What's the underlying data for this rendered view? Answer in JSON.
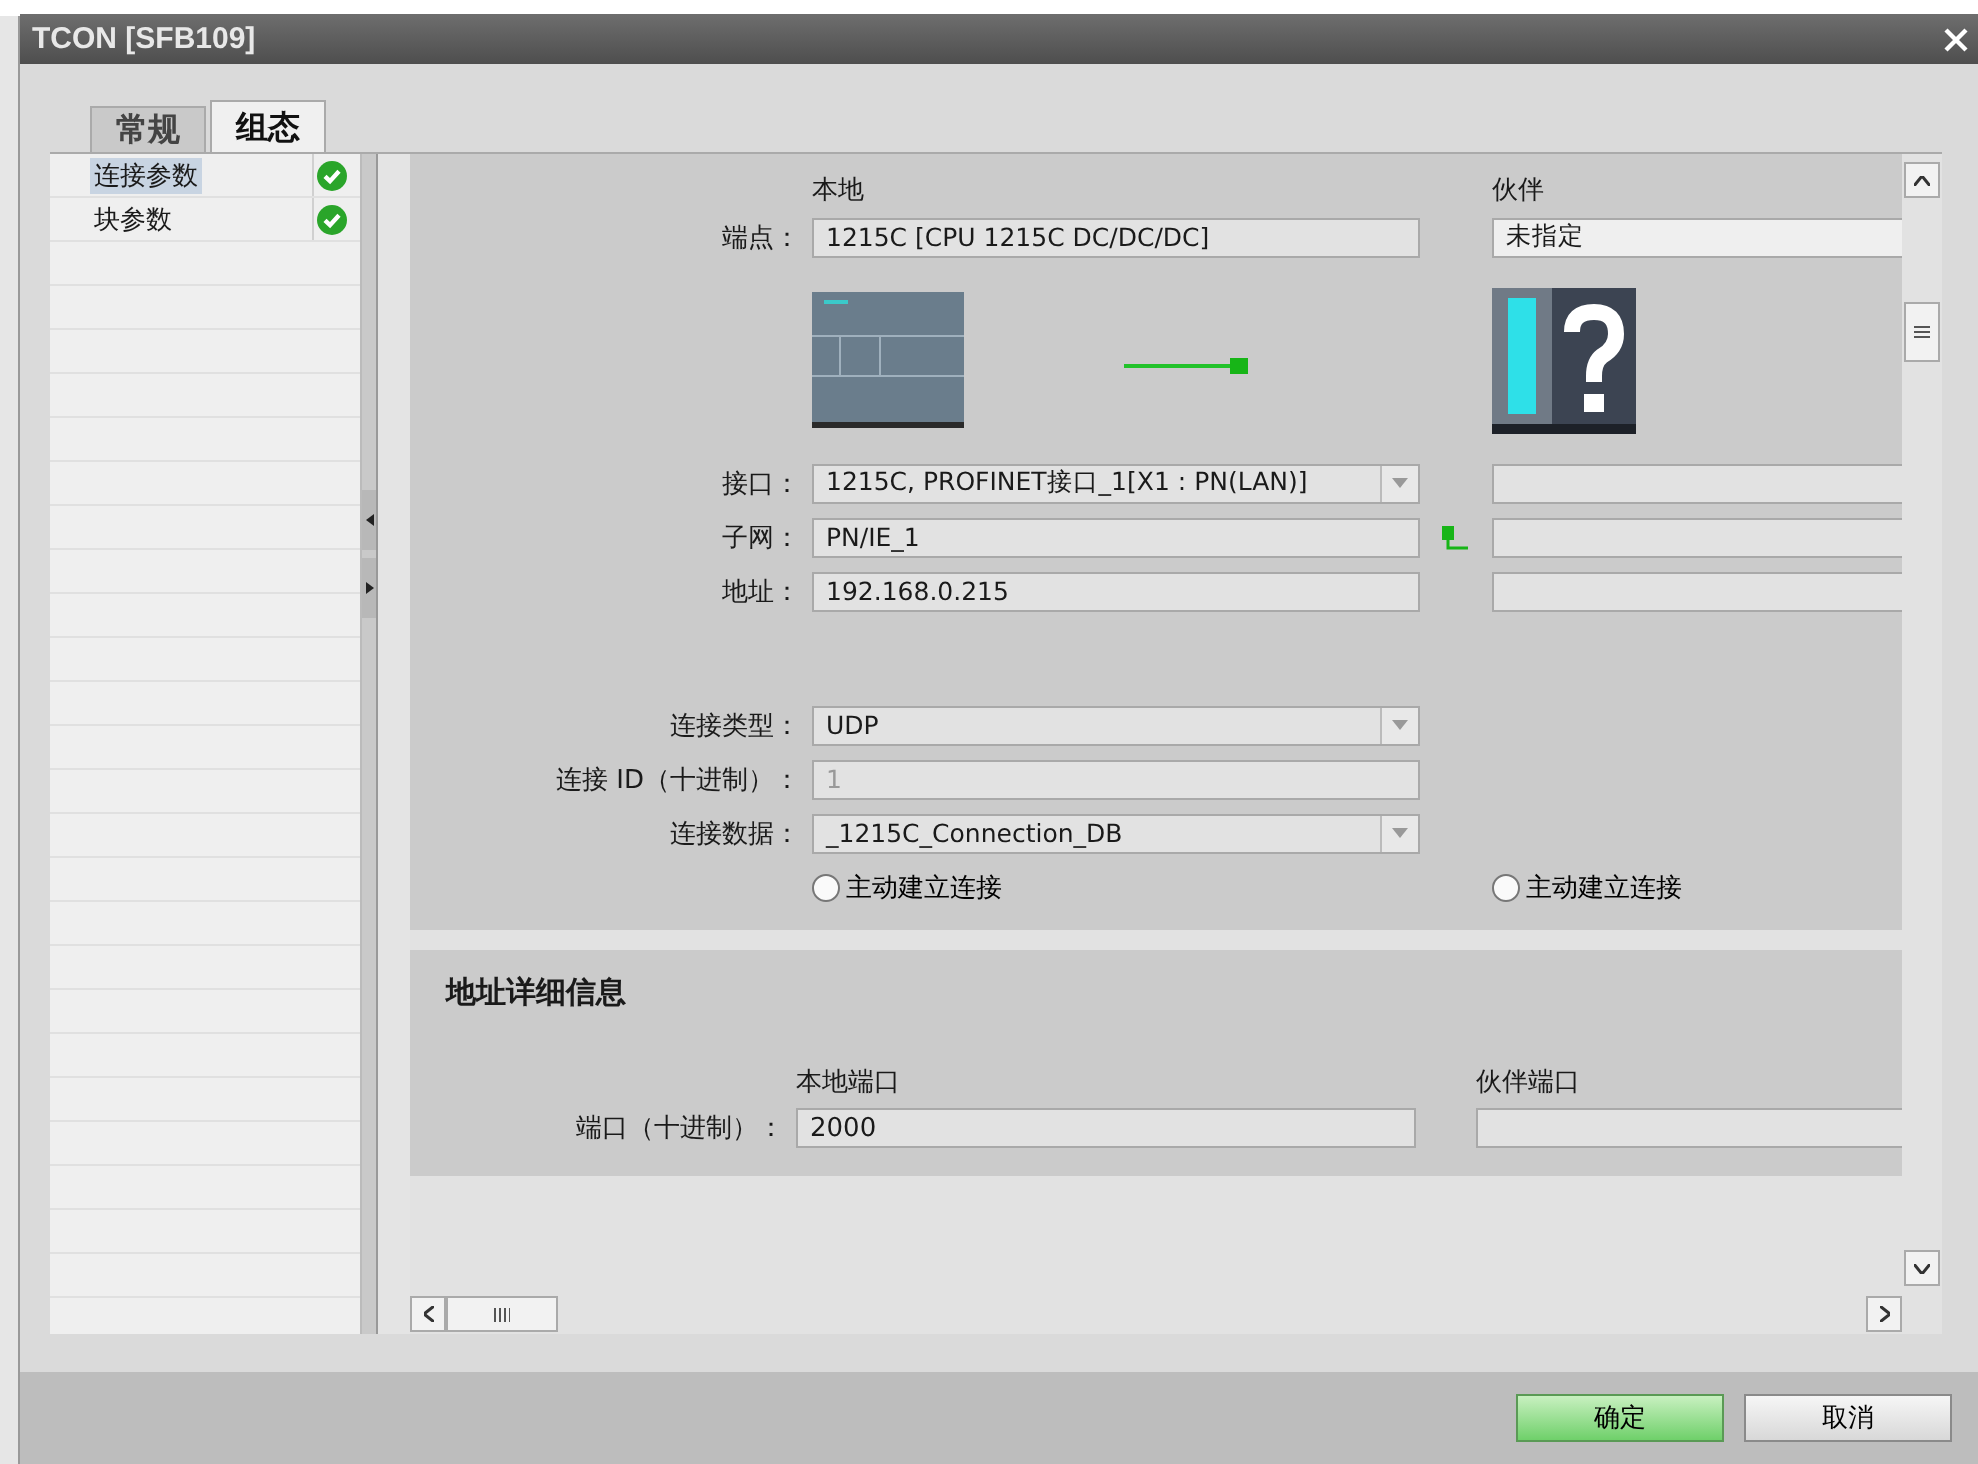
{
  "window": {
    "title": "TCON [SFB109]"
  },
  "tabs": [
    {
      "label": "常规",
      "selected": false
    },
    {
      "label": "组态",
      "selected": true
    }
  ],
  "nav": {
    "items": [
      {
        "label": "连接参数",
        "selected": true,
        "valid": true
      },
      {
        "label": "块参数",
        "selected": false,
        "valid": true
      }
    ]
  },
  "connection": {
    "local_header": "本地",
    "partner_header": "伙伴",
    "endpoint": {
      "label": "端点：",
      "local": "1215C [CPU 1215C DC/DC/DC]",
      "partner": "未指定"
    },
    "fields": [
      {
        "label": "接口：",
        "kind": "dropdown",
        "value": "1215C, PROFINET接口_1[X1 : PN(LAN)]",
        "partner": true,
        "linked": false
      },
      {
        "label": "子网：",
        "kind": "text",
        "value": "PN/IE_1",
        "partner": true,
        "linked": true
      },
      {
        "label": "地址：",
        "kind": "text",
        "value": "192.168.0.215",
        "partner": true,
        "linked": false
      },
      {
        "kind": "gap"
      },
      {
        "label": "连接类型：",
        "kind": "dropdown",
        "value": "UDP",
        "partner": false,
        "linked": false
      },
      {
        "label": "连接 ID（十进制）：",
        "kind": "disabled",
        "value": "1",
        "partner": false,
        "linked": false
      },
      {
        "label": "连接数据：",
        "kind": "dropdown",
        "value": "_1215C_Connection_DB",
        "partner": false,
        "linked": false
      }
    ],
    "radios": [
      {
        "label": "主动建立连接",
        "selected": false
      },
      {
        "label": "主动建立连接",
        "selected": false
      }
    ]
  },
  "address_details": {
    "title": "地址详细信息",
    "local_header": "本地端口",
    "partner_header": "伙伴端口",
    "row_label": "端口（十进制）：",
    "local_value": "2000"
  },
  "buttons": [
    {
      "label": "确定",
      "kind": "primary"
    },
    {
      "label": "取消",
      "kind": "normal"
    }
  ]
}
